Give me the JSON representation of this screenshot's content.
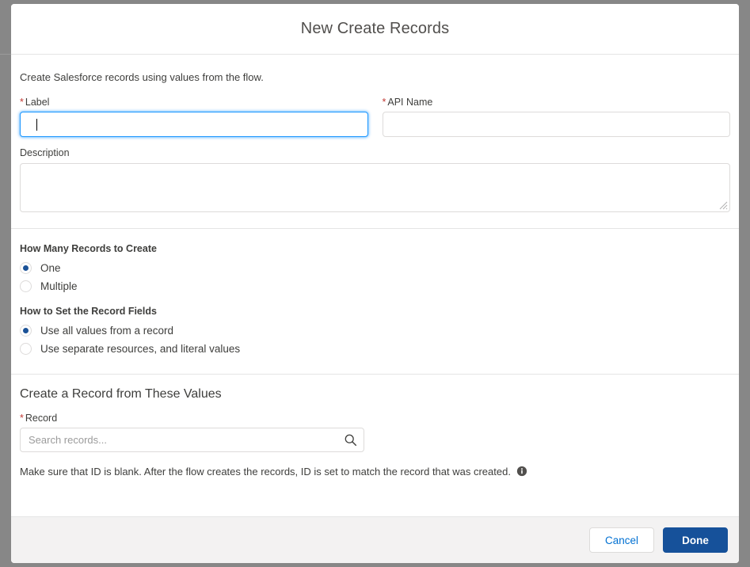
{
  "modal": {
    "title": "New Create Records",
    "intro": "Create Salesforce records using values from the flow."
  },
  "fields": {
    "label": {
      "label": "Label",
      "required_marker": "*",
      "value": "",
      "placeholder": ""
    },
    "api_name": {
      "label": "API Name",
      "required_marker": "*",
      "value": "",
      "placeholder": ""
    },
    "description": {
      "label": "Description",
      "value": "",
      "placeholder": ""
    }
  },
  "record_count": {
    "legend": "How Many Records to Create",
    "options": [
      {
        "label": "One",
        "checked": true
      },
      {
        "label": "Multiple",
        "checked": false
      }
    ]
  },
  "record_fields_mode": {
    "legend": "How to Set the Record Fields",
    "options": [
      {
        "label": "Use all values from a record",
        "checked": true
      },
      {
        "label": "Use separate resources, and literal values",
        "checked": false
      }
    ]
  },
  "record_section": {
    "heading": "Create a Record from These Values",
    "record_label": "Record",
    "required_marker": "*",
    "search_placeholder": "Search records...",
    "search_value": "",
    "search_icon": "search-icon",
    "help_text": "Make sure that ID is blank. After the flow creates the records, ID is set to match the record that was created.",
    "help_icon": "info-icon"
  },
  "footer": {
    "cancel_label": "Cancel",
    "done_label": "Done"
  },
  "colors": {
    "brand_blue": "#16519a",
    "link_blue": "#0070d2",
    "radio_blue": "#1b5297",
    "focus_blue": "#1b96ff",
    "required_red": "#c23934",
    "backdrop": "#878787",
    "footer_bg": "#f3f2f2",
    "border": "#dddbda"
  }
}
